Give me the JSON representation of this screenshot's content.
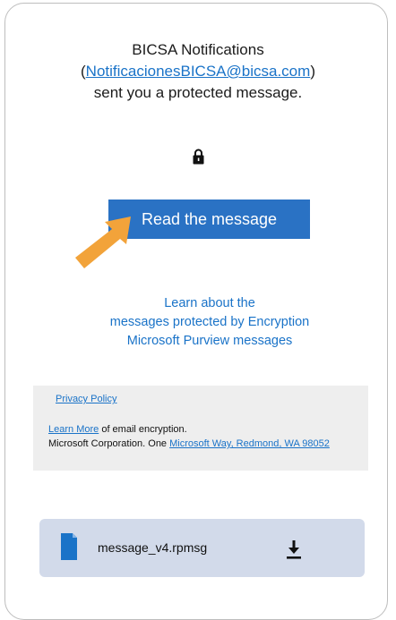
{
  "message": {
    "sender_name": "BICSA Notifications",
    "sender_email": "NotificacionesBICSA@bicsa.com",
    "body_suffix": "sent you a protected message.",
    "open_paren": "(",
    "close_paren": ")"
  },
  "icons": {
    "lock": "lock-icon",
    "pointer": "arrow-pointer-icon",
    "file": "document-icon",
    "download": "download-icon"
  },
  "read_button": {
    "label": "Read the message",
    "color": "#2a72c4"
  },
  "learn_links": [
    "Learn about the",
    "messages protected by Encryption",
    "Microsoft Purview messages"
  ],
  "footer": {
    "privacy_link": "Privacy Policy ",
    "learn_more_link": "Learn More",
    "learn_more_suffix": " of email encryption.",
    "corp_prefix": "Microsoft Corporation. One ",
    "address_link": "Microsoft Way, Redmond, WA 98052"
  },
  "attachment": {
    "file_name": "message_v4.rpmsg"
  },
  "colors": {
    "accent": "#1a73c8",
    "arrow": "#f2a33a",
    "attachment_bg": "#d2daea",
    "footer_bg": "#eeeeee"
  }
}
